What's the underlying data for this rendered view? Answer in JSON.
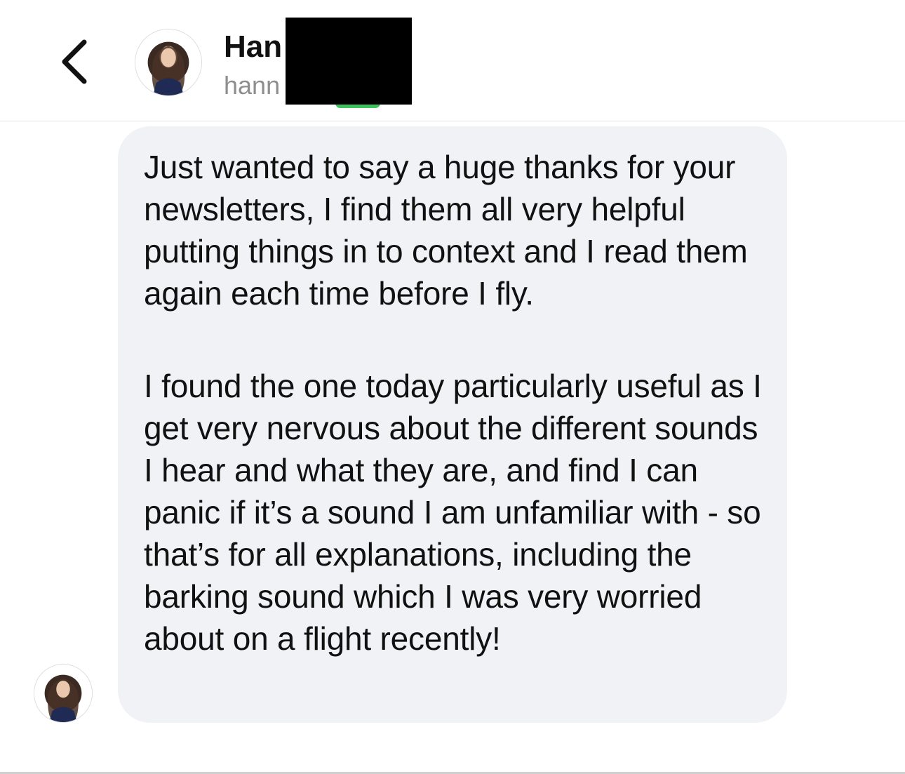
{
  "header": {
    "back_icon": "chevron-left-icon",
    "display_name": "Han",
    "username": "hann",
    "avatar": "profile-photo",
    "online_color": "#3cc45a"
  },
  "message": {
    "paragraphs": [
      "Just wanted to say a huge thanks for your newsletters, I find them all very helpful putting things in to context and I read them again each time before I fly.",
      "I found the one today particularly useful as I get very nervous about the different sounds I hear and what they are, and find I can panic if it’s a sound I am unfamiliar with - so that’s for all explanations, including the barking sound which I was very worried about on a flight recently!"
    ],
    "bubble_color": "#f1f2f5"
  }
}
